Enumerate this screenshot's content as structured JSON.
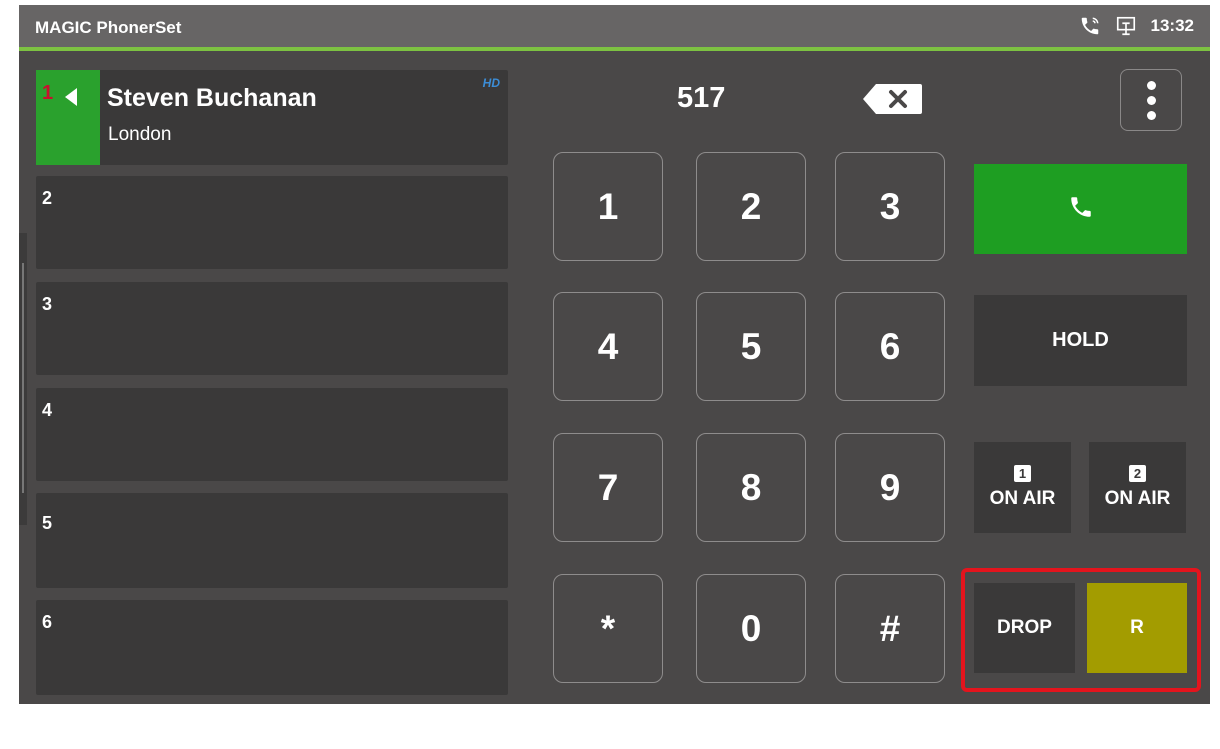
{
  "app": {
    "title": "MAGIC PhonerSet",
    "time": "13:32"
  },
  "status_icons": [
    "phone-call-icon",
    "network-icon"
  ],
  "lines": [
    {
      "number": "1",
      "caller_name": "Steven Buchanan",
      "caller_location": "London",
      "hd_label": "HD",
      "active": true
    },
    {
      "number": "2"
    },
    {
      "number": "3"
    },
    {
      "number": "4"
    },
    {
      "number": "5"
    },
    {
      "number": "6"
    }
  ],
  "dialer": {
    "display_number": "517",
    "keys": [
      "1",
      "2",
      "3",
      "4",
      "5",
      "6",
      "7",
      "8",
      "9",
      "*",
      "0",
      "#"
    ]
  },
  "actions": {
    "hold_label": "HOLD",
    "on_air_1_badge": "1",
    "on_air_1_label": "ON AIR",
    "on_air_2_badge": "2",
    "on_air_2_label": "ON AIR",
    "drop_label": "DROP",
    "r_label": "R"
  },
  "colors": {
    "accent_green": "#7dc242",
    "call_green": "#1e9e22",
    "active_line_green": "#2aa12d",
    "r_button": "#a39c00",
    "highlight_red": "#e4141d",
    "hd_blue": "#3c8dd6"
  }
}
